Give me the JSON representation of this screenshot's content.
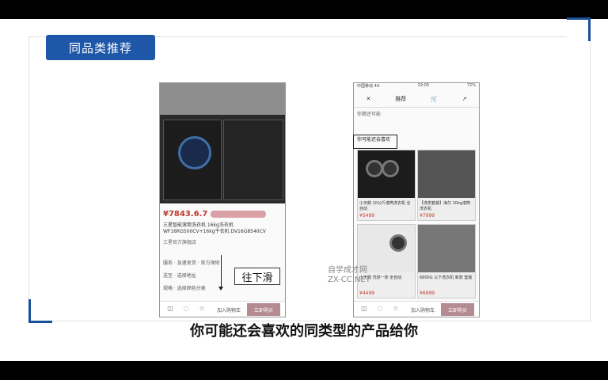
{
  "slide": {
    "title": "同品类推荐",
    "subtitle": "你可能还会喜欢的同类型的产品给你",
    "annotation": "往下滑",
    "watermark_line1": "自学成才网",
    "watermark_line2": "ZX-CC.NET",
    "accent_color": "#1e56a8"
  },
  "left_phone": {
    "price": "¥7843.6.7",
    "description": "三星智能滚筒洗衣机 16kg洗衣机 WF16RG500CV+16kg干衣机 DV16G8540CV",
    "shop": "三星官方旗舰店",
    "rows": [
      "服务 · 急速发货 · 官方保修",
      "送至 · 选择地址",
      "规格 · 选择颜色分类"
    ],
    "cart_label": "加入购物车",
    "buy_label": "立即购买"
  },
  "right_phone": {
    "status_left": "中国移动 4G",
    "status_center": "19:00",
    "status_right": "72%",
    "nav_title": "推荐",
    "section_label": "你猜还可能",
    "highlight_label": "你可能还会喜欢",
    "cards": [
      {
        "text": "小天鹅 10公斤滚筒洗衣机 全自动",
        "price": "¥5499"
      },
      {
        "text": "【洗烘套装】海尔 10kg滚筒洗衣机",
        "price": "¥7999"
      },
      {
        "text": "小天鹅 洗烘一体 全自动",
        "price": "¥4499"
      },
      {
        "text": "6800G 以下洗衣机 新款 套装",
        "price": "¥6999"
      }
    ],
    "cart_label": "加入购物车",
    "buy_label": "立即购买"
  }
}
